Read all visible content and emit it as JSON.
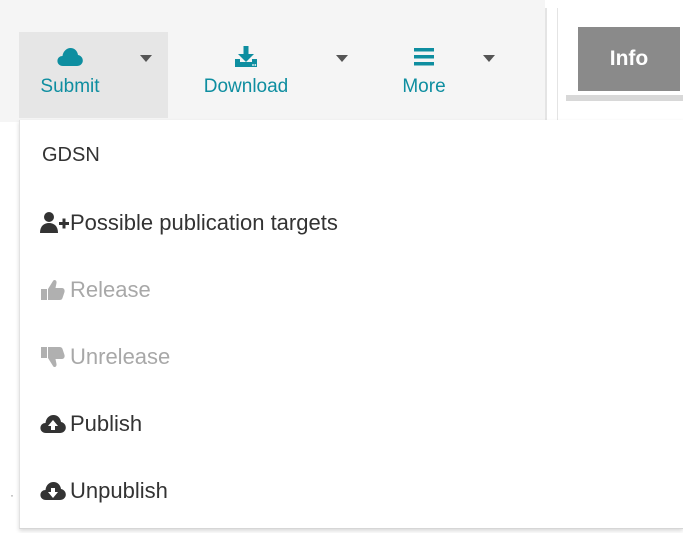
{
  "toolbar": {
    "buttons": [
      {
        "label": "Submit",
        "icon": "cloud-icon"
      },
      {
        "label": "Download",
        "icon": "download-icon"
      },
      {
        "label": "More",
        "icon": "hamburger-menu-icon"
      }
    ],
    "accent_color": "#0e8ea0"
  },
  "tab": {
    "info_label": "Info",
    "color": "#8a8a8a"
  },
  "menu": {
    "header": "GDSN",
    "items": [
      {
        "label": "Possible publication targets",
        "icon": "add-user-icon",
        "disabled": false
      },
      {
        "label": "Release",
        "icon": "thumbs-up-icon",
        "disabled": true
      },
      {
        "label": "Unrelease",
        "icon": "thumbs-down-icon",
        "disabled": true
      },
      {
        "label": "Publish",
        "icon": "cloud-upload-icon",
        "disabled": false
      },
      {
        "label": "Unpublish",
        "icon": "cloud-download-icon",
        "disabled": false
      }
    ]
  }
}
